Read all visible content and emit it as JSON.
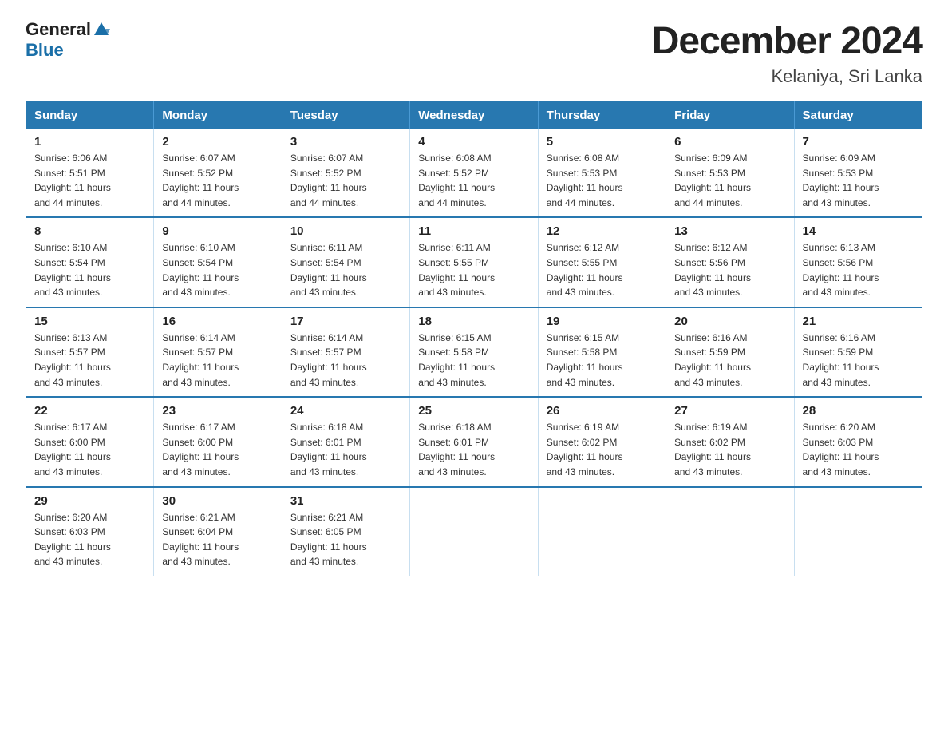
{
  "logo": {
    "general": "General",
    "blue": "Blue"
  },
  "title": "December 2024",
  "subtitle": "Kelaniya, Sri Lanka",
  "days_header": [
    "Sunday",
    "Monday",
    "Tuesday",
    "Wednesday",
    "Thursday",
    "Friday",
    "Saturday"
  ],
  "weeks": [
    [
      {
        "day": "1",
        "sunrise": "6:06 AM",
        "sunset": "5:51 PM",
        "daylight": "11 hours and 44 minutes."
      },
      {
        "day": "2",
        "sunrise": "6:07 AM",
        "sunset": "5:52 PM",
        "daylight": "11 hours and 44 minutes."
      },
      {
        "day": "3",
        "sunrise": "6:07 AM",
        "sunset": "5:52 PM",
        "daylight": "11 hours and 44 minutes."
      },
      {
        "day": "4",
        "sunrise": "6:08 AM",
        "sunset": "5:52 PM",
        "daylight": "11 hours and 44 minutes."
      },
      {
        "day": "5",
        "sunrise": "6:08 AM",
        "sunset": "5:53 PM",
        "daylight": "11 hours and 44 minutes."
      },
      {
        "day": "6",
        "sunrise": "6:09 AM",
        "sunset": "5:53 PM",
        "daylight": "11 hours and 44 minutes."
      },
      {
        "day": "7",
        "sunrise": "6:09 AM",
        "sunset": "5:53 PM",
        "daylight": "11 hours and 43 minutes."
      }
    ],
    [
      {
        "day": "8",
        "sunrise": "6:10 AM",
        "sunset": "5:54 PM",
        "daylight": "11 hours and 43 minutes."
      },
      {
        "day": "9",
        "sunrise": "6:10 AM",
        "sunset": "5:54 PM",
        "daylight": "11 hours and 43 minutes."
      },
      {
        "day": "10",
        "sunrise": "6:11 AM",
        "sunset": "5:54 PM",
        "daylight": "11 hours and 43 minutes."
      },
      {
        "day": "11",
        "sunrise": "6:11 AM",
        "sunset": "5:55 PM",
        "daylight": "11 hours and 43 minutes."
      },
      {
        "day": "12",
        "sunrise": "6:12 AM",
        "sunset": "5:55 PM",
        "daylight": "11 hours and 43 minutes."
      },
      {
        "day": "13",
        "sunrise": "6:12 AM",
        "sunset": "5:56 PM",
        "daylight": "11 hours and 43 minutes."
      },
      {
        "day": "14",
        "sunrise": "6:13 AM",
        "sunset": "5:56 PM",
        "daylight": "11 hours and 43 minutes."
      }
    ],
    [
      {
        "day": "15",
        "sunrise": "6:13 AM",
        "sunset": "5:57 PM",
        "daylight": "11 hours and 43 minutes."
      },
      {
        "day": "16",
        "sunrise": "6:14 AM",
        "sunset": "5:57 PM",
        "daylight": "11 hours and 43 minutes."
      },
      {
        "day": "17",
        "sunrise": "6:14 AM",
        "sunset": "5:57 PM",
        "daylight": "11 hours and 43 minutes."
      },
      {
        "day": "18",
        "sunrise": "6:15 AM",
        "sunset": "5:58 PM",
        "daylight": "11 hours and 43 minutes."
      },
      {
        "day": "19",
        "sunrise": "6:15 AM",
        "sunset": "5:58 PM",
        "daylight": "11 hours and 43 minutes."
      },
      {
        "day": "20",
        "sunrise": "6:16 AM",
        "sunset": "5:59 PM",
        "daylight": "11 hours and 43 minutes."
      },
      {
        "day": "21",
        "sunrise": "6:16 AM",
        "sunset": "5:59 PM",
        "daylight": "11 hours and 43 minutes."
      }
    ],
    [
      {
        "day": "22",
        "sunrise": "6:17 AM",
        "sunset": "6:00 PM",
        "daylight": "11 hours and 43 minutes."
      },
      {
        "day": "23",
        "sunrise": "6:17 AM",
        "sunset": "6:00 PM",
        "daylight": "11 hours and 43 minutes."
      },
      {
        "day": "24",
        "sunrise": "6:18 AM",
        "sunset": "6:01 PM",
        "daylight": "11 hours and 43 minutes."
      },
      {
        "day": "25",
        "sunrise": "6:18 AM",
        "sunset": "6:01 PM",
        "daylight": "11 hours and 43 minutes."
      },
      {
        "day": "26",
        "sunrise": "6:19 AM",
        "sunset": "6:02 PM",
        "daylight": "11 hours and 43 minutes."
      },
      {
        "day": "27",
        "sunrise": "6:19 AM",
        "sunset": "6:02 PM",
        "daylight": "11 hours and 43 minutes."
      },
      {
        "day": "28",
        "sunrise": "6:20 AM",
        "sunset": "6:03 PM",
        "daylight": "11 hours and 43 minutes."
      }
    ],
    [
      {
        "day": "29",
        "sunrise": "6:20 AM",
        "sunset": "6:03 PM",
        "daylight": "11 hours and 43 minutes."
      },
      {
        "day": "30",
        "sunrise": "6:21 AM",
        "sunset": "6:04 PM",
        "daylight": "11 hours and 43 minutes."
      },
      {
        "day": "31",
        "sunrise": "6:21 AM",
        "sunset": "6:05 PM",
        "daylight": "11 hours and 43 minutes."
      },
      null,
      null,
      null,
      null
    ]
  ],
  "labels": {
    "sunrise": "Sunrise: ",
    "sunset": "Sunset: ",
    "daylight": "Daylight: "
  }
}
